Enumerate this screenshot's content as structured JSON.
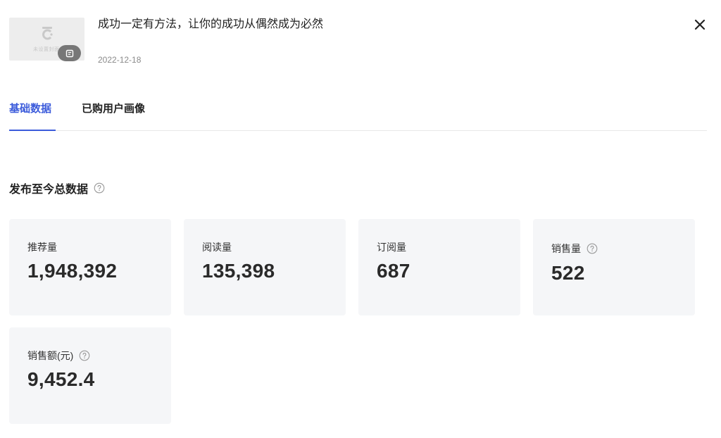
{
  "header": {
    "thumbnail_caption": "未设置封面",
    "title": "成功一定有方法，让你的成功从偶然成为必然",
    "date": "2022-12-18"
  },
  "tabs": [
    {
      "label": "基础数据",
      "active": true
    },
    {
      "label": "已购用户画像",
      "active": false
    }
  ],
  "section": {
    "title": "发布至今总数据"
  },
  "stats": [
    {
      "label": "推荐量",
      "value": "1,948,392",
      "help": false
    },
    {
      "label": "阅读量",
      "value": "135,398",
      "help": false
    },
    {
      "label": "订阅量",
      "value": "687",
      "help": false
    },
    {
      "label": "销售量",
      "value": "522",
      "help": true
    },
    {
      "label": "销售额(元)",
      "value": "9,452.4",
      "help": true
    }
  ],
  "colors": {
    "accent": "#3b5bdb",
    "card_bg": "#f5f6f8"
  },
  "icons": {
    "close": "close-icon",
    "help": "help-circle-icon",
    "doc_badge": "document-icon"
  }
}
